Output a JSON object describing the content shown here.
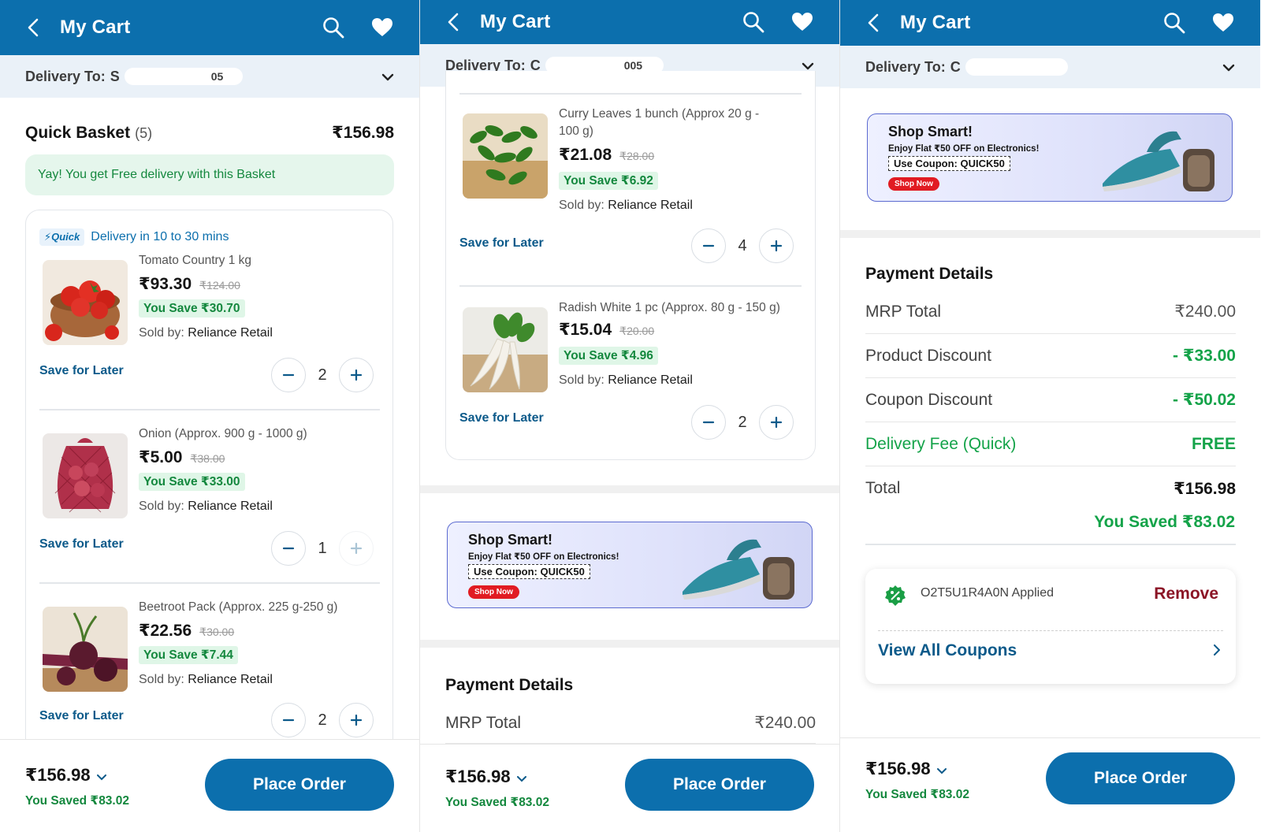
{
  "header": {
    "title": "My Cart"
  },
  "delivery": {
    "label": "Delivery To:",
    "screen1_partial": "S",
    "screen1_tail": "05",
    "screen2_partial": "C",
    "screen2_tail": "005",
    "screen3_partial": "C"
  },
  "basket": {
    "title": "Quick Basket",
    "count": "(5)",
    "total": "₹156.98",
    "free_delivery": "Yay! You get Free delivery with this Basket",
    "quick_badge": "⚡Quick",
    "delivery_time": "Delivery in 10 to 30 mins"
  },
  "labels": {
    "save_for_later": "Save for Later",
    "sold_by": "Sold by:",
    "place_order": "Place Order",
    "footer_total": "₹156.98",
    "footer_saved": "You Saved ₹83.02"
  },
  "items": [
    {
      "name": "Tomato Country 1 kg",
      "price": "₹93.30",
      "mrp": "₹124.00",
      "save": "You Save ₹30.70",
      "seller": "Reliance Retail",
      "qty": "2"
    },
    {
      "name": "Onion (Approx. 900 g - 1000 g)",
      "price": "₹5.00",
      "mrp": "₹38.00",
      "save": "You Save ₹33.00",
      "seller": "Reliance Retail",
      "qty": "1"
    },
    {
      "name": "Beetroot Pack (Approx. 225 g-250 g)",
      "price": "₹22.56",
      "mrp": "₹30.00",
      "save": "You Save ₹7.44",
      "seller": "Reliance Retail",
      "qty": "2"
    },
    {
      "name_line1": "Curry Leaves 1 bunch (Approx 20 g -",
      "name_line2": "100 g)",
      "price": "₹21.08",
      "mrp": "₹28.00",
      "save": "You Save ₹6.92",
      "seller": "Reliance Retail",
      "qty": "4"
    },
    {
      "name": "Radish White 1 pc (Approx. 80 g - 150 g)",
      "price": "₹15.04",
      "mrp": "₹20.00",
      "save": "You Save ₹4.96",
      "seller": "Reliance Retail",
      "qty": "2"
    }
  ],
  "promo": {
    "heading": "Shop Smart!",
    "sub": "Enjoy Flat ₹50 OFF on Electronics!",
    "coupon": "Use Coupon: QUICK50",
    "button": "Shop Now"
  },
  "payment": {
    "title": "Payment Details",
    "mrp_label": "MRP Total",
    "mrp_value": "₹240.00",
    "product_discount_label": "Product Discount",
    "product_discount_value": "- ₹33.00",
    "coupon_discount_label": "Coupon Discount",
    "coupon_discount_value": "- ₹50.02",
    "delivery_fee_label": "Delivery Fee (Quick)",
    "delivery_fee_value": "FREE",
    "total_label": "Total",
    "total_value": "₹156.98",
    "saved": "You Saved ₹83.02"
  },
  "coupon": {
    "applied": "O2T5U1R4A0N Applied",
    "remove": "Remove",
    "view_all": "View All Coupons"
  },
  "colors": {
    "brand": "#0c6fad",
    "green": "#14883e",
    "remove": "#8b1526"
  }
}
